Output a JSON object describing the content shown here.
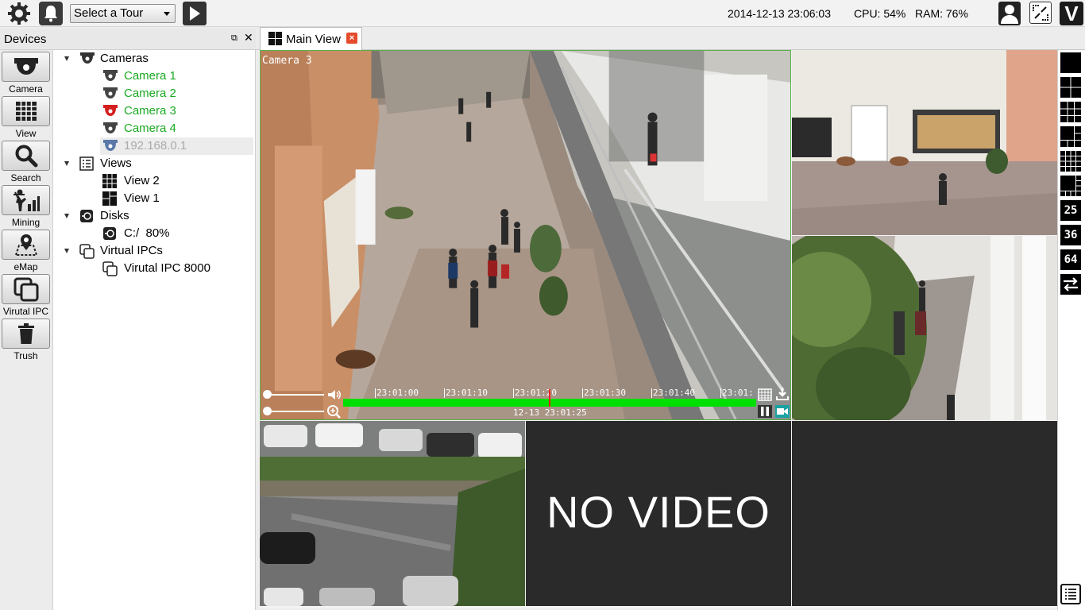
{
  "topbar": {
    "tour_select": "Select a Tour",
    "datetime": "2014-12-13 23:06:03",
    "cpu": "CPU: 54%",
    "ram": "RAM: 76%",
    "logo": "V"
  },
  "panel": {
    "title": "Devices",
    "close": "✕",
    "float": "⧉"
  },
  "tools": [
    {
      "label": "Camera",
      "icon": "camera-icon"
    },
    {
      "label": "View",
      "icon": "grid-icon"
    },
    {
      "label": "Search",
      "icon": "search-icon"
    },
    {
      "label": "Mining",
      "icon": "mining-icon"
    },
    {
      "label": "eMap",
      "icon": "map-icon"
    },
    {
      "label": "Virutal IPC",
      "icon": "virtual-ipc-icon"
    },
    {
      "label": "Trush",
      "icon": "trash-icon"
    }
  ],
  "tree": {
    "cameras": {
      "label": "Cameras",
      "items": [
        "Camera 1",
        "Camera 2",
        "Camera 3",
        "Camera 4",
        "192.168.0.1"
      ]
    },
    "views": {
      "label": "Views",
      "items": [
        "View 2",
        "View 1"
      ]
    },
    "disks": {
      "label": "Disks",
      "items": [
        "C:/  80%"
      ]
    },
    "virtual": {
      "label": "Virtual IPCs",
      "items": [
        "Virutal IPC 8000"
      ]
    }
  },
  "tabs": {
    "main": "Main View",
    "close": "×"
  },
  "video": {
    "main_overlay": "Camera 3",
    "no_video": "NO VIDEO",
    "timeline_ticks": [
      "23:01:00",
      "23:01:10",
      "23:01:20",
      "23:01:30",
      "23:01:40",
      "23:01:"
    ],
    "timeline_time": "12-13 23:01:25"
  },
  "layouts": {
    "n25": "25",
    "n36": "36",
    "n64": "64"
  },
  "colors": {
    "camera_ok": "#1aaa22",
    "camera_alarm": "#d52020",
    "camera_offline": "#aaaaaa",
    "timeline": "#00e000",
    "cursor": "#ff1a1a"
  }
}
